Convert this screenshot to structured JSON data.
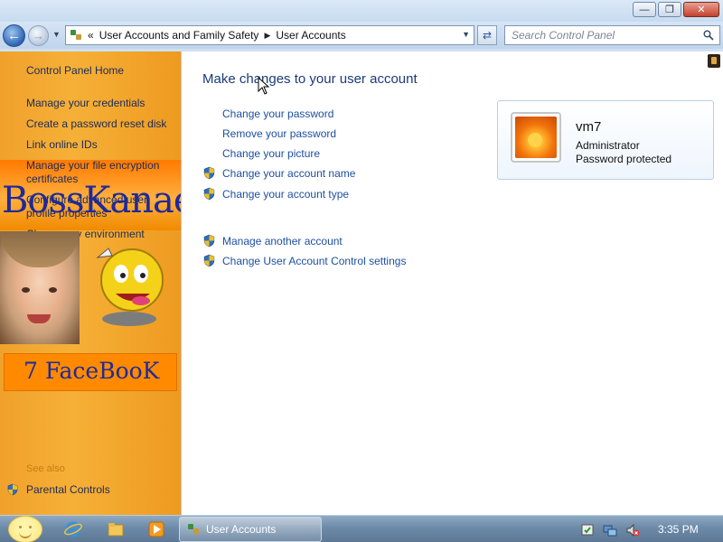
{
  "window": {
    "minimize_icon": "minimize-icon",
    "maximize_icon": "maximize-icon",
    "close_icon": "close-icon"
  },
  "navigation": {
    "back_glyph": "←",
    "forward_glyph": "→",
    "breadcrumb_prefix": "«",
    "breadcrumb": [
      "User Accounts and Family Safety",
      "User Accounts"
    ],
    "search_placeholder": "Search Control Panel"
  },
  "sidebar": {
    "home": "Control Panel Home",
    "items": [
      "Manage your credentials",
      "Create a password reset disk",
      "Link online IDs",
      "Manage your file encryption certificates",
      "Configure advanced user profile properties",
      "Change my environment variables"
    ],
    "see_also": "See also",
    "parental_controls": "Parental Controls",
    "overlay_banner_text": "BossKanae",
    "overlay_fb_text": "7 FaceBooK"
  },
  "main": {
    "heading": "Make changes to your user account",
    "tasks": [
      {
        "label": "Change your password",
        "shield": false
      },
      {
        "label": "Remove your password",
        "shield": false
      },
      {
        "label": "Change your picture",
        "shield": false
      },
      {
        "label": "Change your account name",
        "shield": true
      },
      {
        "label": "Change your account type",
        "shield": true
      }
    ],
    "other_tasks": [
      {
        "label": "Manage another account",
        "shield": true
      },
      {
        "label": "Change User Account Control settings",
        "shield": true
      }
    ],
    "account": {
      "name": "vm7",
      "role": "Administrator",
      "status": "Password protected"
    }
  },
  "taskbar": {
    "active_task": "User Accounts",
    "clock": "3:35 PM"
  },
  "colors": {
    "sidebar_orange": "#f6b037",
    "link_blue": "#1d4fa0",
    "heading_blue": "#1a3a7a",
    "banner_text": "#1f2a9a"
  }
}
